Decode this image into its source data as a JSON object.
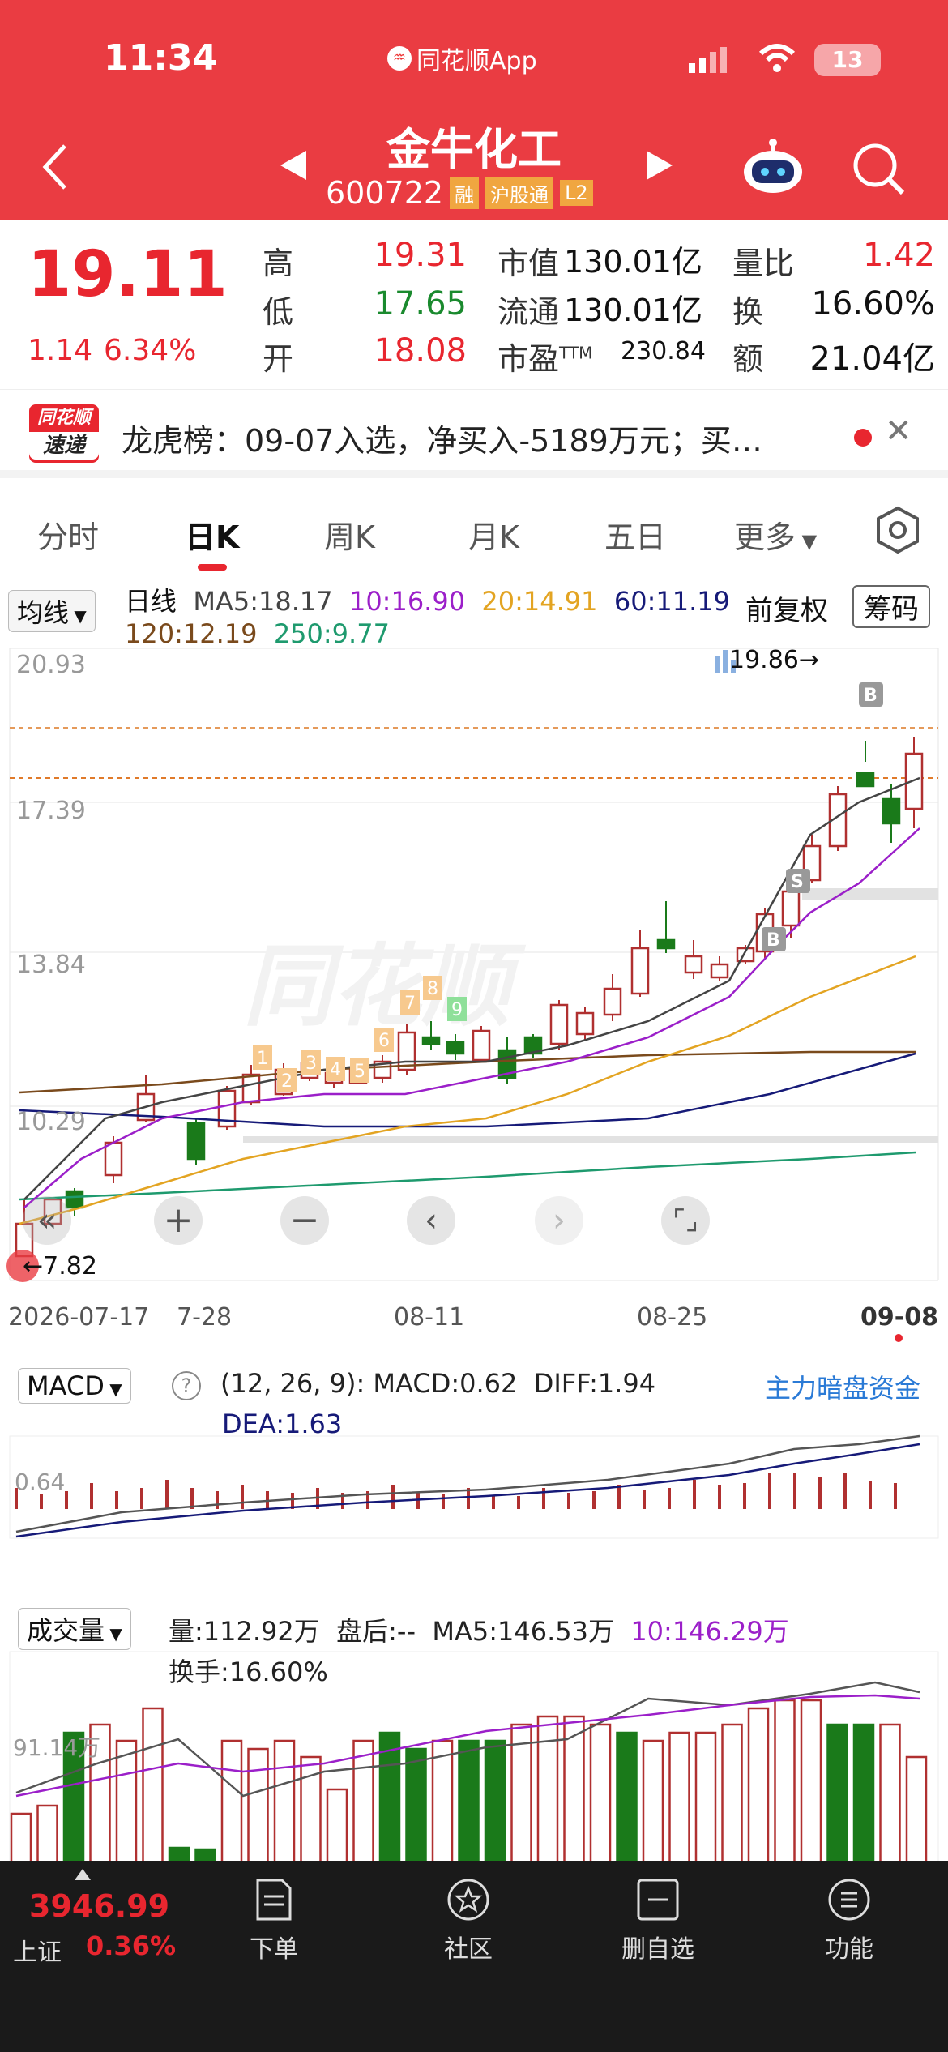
{
  "status_bar": {
    "time": "11:34",
    "app": "同花顺App",
    "battery": "13"
  },
  "header": {
    "name": "金牛化工",
    "code": "600722",
    "tags": [
      "融",
      "沪股通",
      "L2"
    ]
  },
  "quote": {
    "price": "19.11",
    "change": "1.14",
    "change_pct": "6.34%",
    "high_label": "高",
    "high": "19.31",
    "low_label": "低",
    "low": "17.65",
    "open_label": "开",
    "open": "18.08",
    "mcap_label": "市值",
    "mcap": "130.01亿",
    "float_label": "流通",
    "float": "130.01亿",
    "pe_label": "市盈",
    "pe_sup": "TTM",
    "pe": "230.84",
    "vr_label": "量比",
    "vr": "1.42",
    "turn_label": "换",
    "turn": "16.60%",
    "amt_label": "额",
    "amt": "21.04亿"
  },
  "news": {
    "logo_line1": "同花顺",
    "logo_line2": "速递",
    "text": "龙虎榜：09-07入选，净买入-5189万元；买…"
  },
  "tabs": [
    "分时",
    "日K",
    "周K",
    "月K",
    "五日",
    "更多"
  ],
  "active_tab": "日K",
  "kline": {
    "ma_button": "均线",
    "period": "日线",
    "ma5": "MA5:18.17",
    "ma10": "10:16.90",
    "ma20": "20:14.91",
    "ma60": "60:11.19",
    "ma120": "120:12.19",
    "ma250": "250:9.77",
    "adjust": "前复权",
    "chips": "筹码",
    "y_labels": [
      "20.93",
      "17.39",
      "13.84",
      "10.29"
    ],
    "max_label": "19.86→",
    "min_label": "←7.82",
    "dates": [
      "2026-07-17",
      "7-28",
      "08-11",
      "08-25",
      "09-08"
    ],
    "signal_B": "B",
    "signal_S": "S",
    "seq_labels": [
      "1",
      "2",
      "3",
      "4",
      "5",
      "6",
      "7",
      "8",
      "9"
    ]
  },
  "macd": {
    "name": "MACD",
    "params": "(12, 26, 9):",
    "macd": "MACD:0.62",
    "diff": "DIFF:1.94",
    "dea": "DEA:1.63",
    "link": "主力暗盘资金",
    "y_label": "0.64"
  },
  "volume": {
    "name": "成交量",
    "vol": "量:112.92万",
    "after": "盘后:--",
    "ma5": "MA5:146.53万",
    "ma10": "10:146.29万",
    "turnover": "换手:16.60%",
    "y_label": "91.14万"
  },
  "bottom": {
    "index_value": "3946.99",
    "index_name": "上证",
    "index_pct": "0.36%",
    "buttons": [
      "下单",
      "社区",
      "删自选",
      "功能"
    ]
  },
  "colors": {
    "up": "#e8262f",
    "down": "#1a7a1a",
    "header": "#ea3c42"
  }
}
